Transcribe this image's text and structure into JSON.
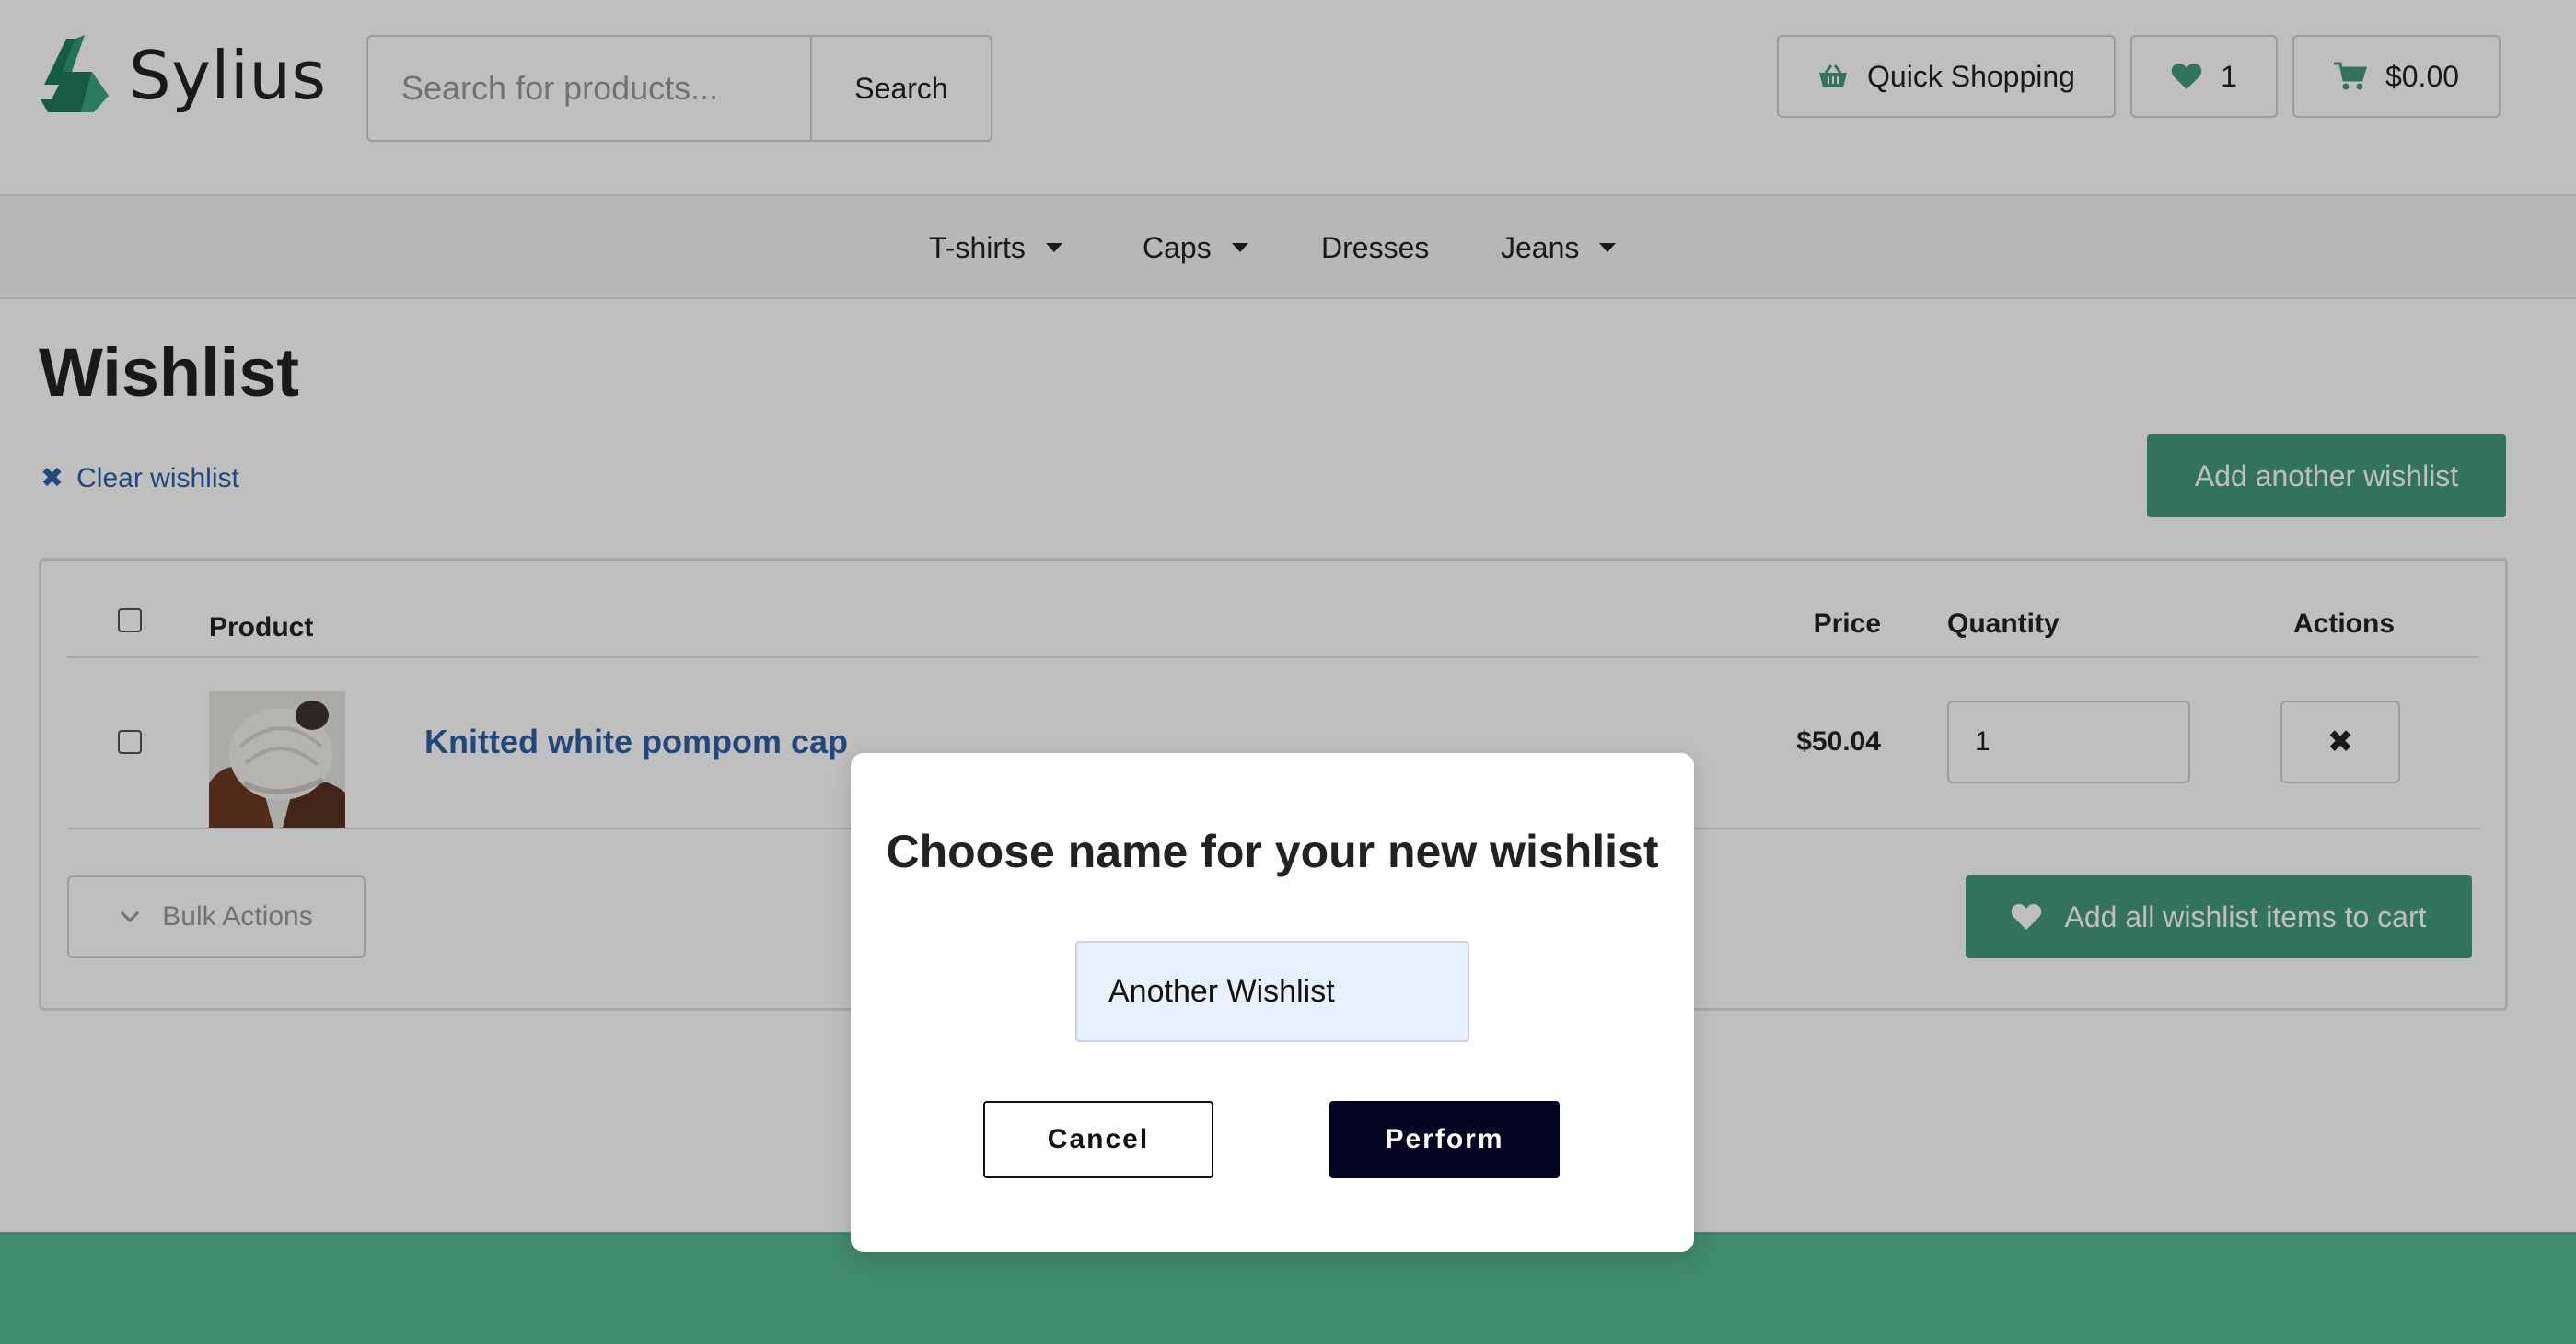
{
  "header": {
    "logo_text": "Sylius",
    "search_placeholder": "Search for products...",
    "search_button": "Search",
    "quick_shopping_label": "Quick Shopping",
    "wishlist_count": "1",
    "cart_total": "$0.00"
  },
  "nav": {
    "items": [
      {
        "label": "T-shirts",
        "dropdown": true
      },
      {
        "label": "Caps",
        "dropdown": true
      },
      {
        "label": "Dresses",
        "dropdown": false
      },
      {
        "label": "Jeans",
        "dropdown": true
      }
    ]
  },
  "main": {
    "title": "Wishlist",
    "clear_label": "Clear wishlist",
    "add_wishlist_label": "Add another wishlist",
    "table": {
      "headers": {
        "product": "Product",
        "price": "Price",
        "quantity": "Quantity",
        "actions": "Actions"
      },
      "rows": [
        {
          "name": "Knitted white pompom cap",
          "price": "$50.04",
          "quantity": "1"
        }
      ]
    },
    "bulk_actions_label": "Bulk Actions",
    "add_all_label": "Add all wishlist items to cart"
  },
  "modal": {
    "title": "Choose name for your new wishlist",
    "input_value": "Another Wishlist",
    "cancel_label": "Cancel",
    "perform_label": "Perform"
  },
  "colors": {
    "brand_green": "#449a7b",
    "link_blue": "#2e5fa3",
    "perform_navy": "#050523",
    "footer_green": "#57b893"
  },
  "icons": {
    "logo": "sylius-swan-logo",
    "quick_shopping": "basket-icon",
    "wishlist": "heart-icon",
    "cart": "cart-icon",
    "clear": "close-icon",
    "remove": "close-icon",
    "bulk": "chevron-down-icon",
    "add_all": "heart-icon"
  }
}
